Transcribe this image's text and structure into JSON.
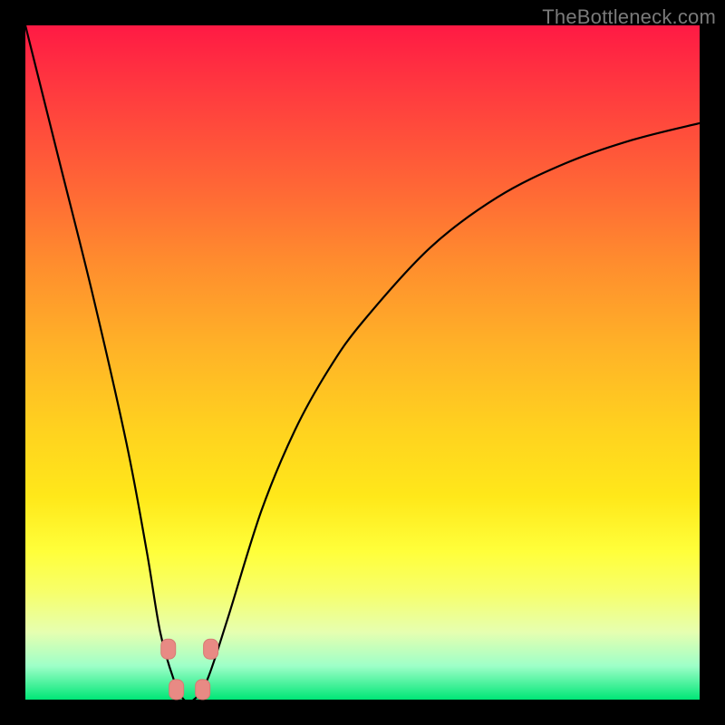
{
  "watermark": "TheBottleneck.com",
  "colors": {
    "background": "#000000",
    "gradient_top": "#ff1a44",
    "gradient_bottom": "#00e676",
    "curve": "#000000",
    "marker": "#e88a84"
  },
  "chart_data": {
    "type": "line",
    "title": "",
    "xlabel": "",
    "ylabel": "",
    "xlim": [
      0,
      1
    ],
    "ylim": [
      0,
      1
    ],
    "x": [
      0.0,
      0.05,
      0.1,
      0.15,
      0.18,
      0.2,
      0.22,
      0.235,
      0.25,
      0.27,
      0.3,
      0.35,
      0.4,
      0.45,
      0.5,
      0.6,
      0.7,
      0.8,
      0.9,
      1.0
    ],
    "y": [
      1.0,
      0.8,
      0.6,
      0.38,
      0.22,
      0.1,
      0.03,
      0.0,
      0.0,
      0.03,
      0.12,
      0.28,
      0.4,
      0.49,
      0.56,
      0.67,
      0.745,
      0.795,
      0.83,
      0.855
    ],
    "minimum_x": 0.245,
    "markers": [
      {
        "x": 0.212,
        "y": 0.075
      },
      {
        "x": 0.275,
        "y": 0.075
      },
      {
        "x": 0.224,
        "y": 0.015
      },
      {
        "x": 0.263,
        "y": 0.015
      }
    ],
    "notes": "y is fraction of plot height from bottom; curve is asymmetric V with sharp left descent and rounded right ascent; minimum near x≈0.245 touching y=0 (green band)."
  }
}
